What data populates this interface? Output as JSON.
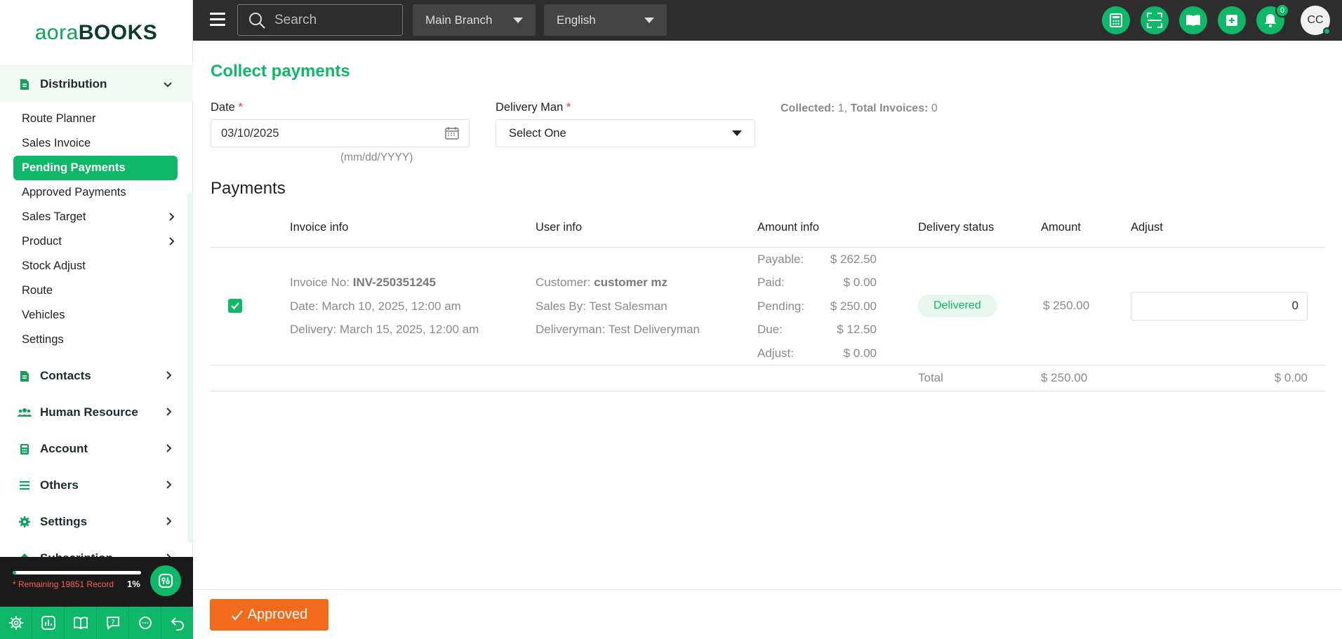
{
  "brand": {
    "logo_part1": "aora",
    "logo_part2": "BOOKS",
    "accent": "#0fb868",
    "danger": "#f26a1b"
  },
  "topbar": {
    "search_placeholder": "Search",
    "branch": "Main Branch",
    "language": "English",
    "notification_count": "0",
    "avatar_initials": "CC"
  },
  "sidebar": {
    "distribution": {
      "label": "Distribution",
      "items": [
        {
          "label": "Route Planner"
        },
        {
          "label": "Sales Invoice"
        },
        {
          "label": "Pending Payments"
        },
        {
          "label": "Approved Payments"
        },
        {
          "label": "Sales Target"
        },
        {
          "label": "Product"
        },
        {
          "label": "Stock Adjust"
        },
        {
          "label": "Route"
        },
        {
          "label": "Vehicles"
        },
        {
          "label": "Settings"
        }
      ]
    },
    "groups": [
      {
        "label": "Contacts"
      },
      {
        "label": "Human Resource"
      },
      {
        "label": "Account"
      },
      {
        "label": "Others"
      },
      {
        "label": "Settings"
      },
      {
        "label": "Subscription"
      }
    ],
    "usage": {
      "remaining_text": "* Remaining 19851 Record",
      "percent_label": "1%",
      "percent_value": 1
    }
  },
  "main": {
    "title": "Collect payments",
    "date_label": "Date",
    "date_value": "03/10/2025",
    "date_hint": "(mm/dd/YYYY)",
    "delivery_label": "Delivery Man",
    "delivery_value": "Select One",
    "required_mark": "*",
    "collected_label": "Collected:",
    "collected_value": "1,",
    "total_invoices_label": "Total Invoices:",
    "total_invoices_value": "0",
    "payments_title": "Payments",
    "columns": [
      "Invoice info",
      "User info",
      "Amount info",
      "Delivery status",
      "Amount",
      "Adjust"
    ],
    "row": {
      "invoice_no_label": "Invoice No:",
      "invoice_no": "INV-250351245",
      "date_line": "Date: March 10, 2025, 12:00 am",
      "delivery_line": "Delivery: March 15, 2025, 12:00 am",
      "customer_label": "Customer:",
      "customer": "customer mz",
      "sales_by": "Sales By: Test Salesman",
      "deliveryman": "Deliveryman: Test Deliveryman",
      "amounts": [
        {
          "k": "Payable:",
          "v": "$ 262.50"
        },
        {
          "k": "Paid:",
          "v": "$ 0.00"
        },
        {
          "k": "Pending:",
          "v": "$ 250.00"
        },
        {
          "k": "Due:",
          "v": "$ 12.50"
        },
        {
          "k": "Adjust:",
          "v": "$ 0.00"
        }
      ],
      "status": "Delivered",
      "amount": "$ 250.00",
      "adjust_value": "0"
    },
    "total_label": "Total",
    "total_amount": "$ 250.00",
    "total_adjust": "$ 0.00"
  },
  "footer": {
    "approve_label": "Approved"
  }
}
